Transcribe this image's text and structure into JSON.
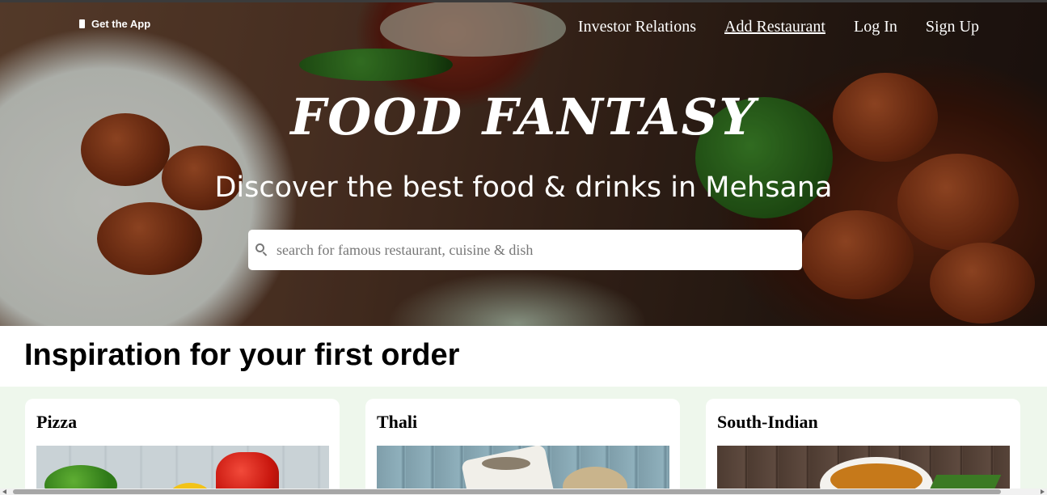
{
  "header": {
    "get_app_label": "Get the App",
    "nav": [
      {
        "label": "Investor Relations"
      },
      {
        "label": "Add Restaurant"
      },
      {
        "label": "Log In"
      },
      {
        "label": "Sign Up"
      }
    ]
  },
  "hero": {
    "brand": "FOOD FANTASY",
    "tagline": "Discover the best food & drinks in Mehsana"
  },
  "search": {
    "placeholder": "search for famous restaurant, cuisine & dish",
    "value": ""
  },
  "inspiration": {
    "title": "Inspiration for your first order",
    "cards": [
      {
        "title": "Pizza"
      },
      {
        "title": "Thali"
      },
      {
        "title": "South-Indian"
      }
    ]
  }
}
